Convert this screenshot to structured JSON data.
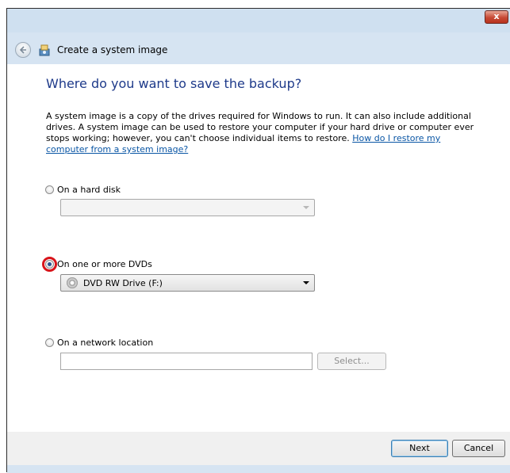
{
  "window": {
    "close_label": "x"
  },
  "header": {
    "title": "Create a system image"
  },
  "main": {
    "heading": "Where do you want to save the backup?",
    "description": "A system image is a copy of the drives required for Windows to run. It can also include additional drives. A system image can be used to restore your computer if your hard drive or computer ever stops working; however, you can't choose individual items to restore. ",
    "help_link": "How do I restore my computer from a system image?",
    "options": {
      "hard_disk": {
        "label": "On a hard disk",
        "selected": false,
        "dropdown_value": ""
      },
      "dvd": {
        "label": "On one or more DVDs",
        "selected": true,
        "dropdown_value": "DVD RW Drive (F:)"
      },
      "network": {
        "label": "On a network location",
        "selected": false,
        "input_value": "",
        "select_label": "Select..."
      }
    }
  },
  "footer": {
    "next_label": "Next",
    "cancel_label": "Cancel"
  },
  "colors": {
    "heading": "#1e3a8a",
    "link": "#0a56a5",
    "highlight_ring": "#d8141a"
  }
}
